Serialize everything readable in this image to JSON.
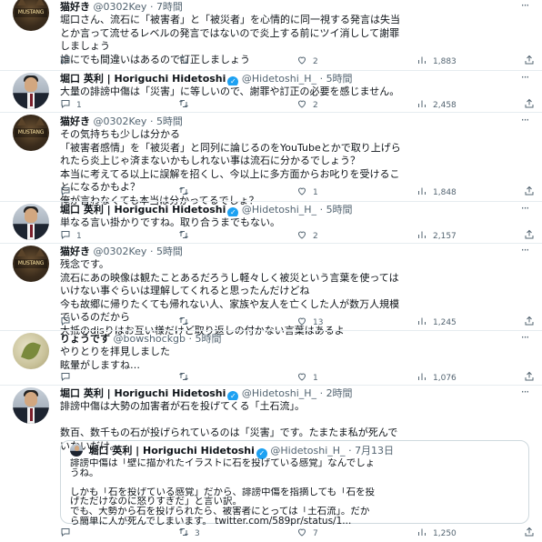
{
  "tweets": [
    {
      "name": "猫好き",
      "handle": "@0302Key",
      "dot": "·",
      "time": "7時間",
      "avatar_text": "MUSTANG",
      "lines": [
        "堀口さん、流石に「被害者」と「被災者」を心情的に同一視する発言は失当",
        "とか言って流せるレベルの発言ではないので炎上する前にツイ消しして謝罪",
        "しましょう",
        "誰にでも間違いはあるので訂正しましょう"
      ],
      "reply_count": "",
      "retweet_count": "",
      "like_count": "2",
      "stats_count": "1,883"
    },
    {
      "name": "堀口 英利 | Horiguchi Hidetoshi",
      "handle": "@Hidetoshi_H_",
      "dot": "·",
      "time": "5時間",
      "lines": [
        "大量の誹謗中傷は「災害」に等しいので、謝罪や訂正の必要を感じません。"
      ],
      "reply_count": "1",
      "retweet_count": "",
      "like_count": "2",
      "stats_count": "2,458"
    },
    {
      "name": "猫好き",
      "handle": "@0302Key",
      "dot": "·",
      "time": "5時間",
      "avatar_text": "MUSTANG",
      "lines": [
        "その気持ちも少しは分かる",
        "「被害者感情」を「被災者」と同列に論じるのをYouTubeとかで取り上げら",
        "れたら炎上じゃ済まないかもしれない事は流石に分かるでしょう？",
        "本当に考えてる以上に誤解を招くし、今以上に多方面からお叱りを受けるこ",
        "とになるかもよ？",
        "俺が言わなくても本当は分かってるでしょ？"
      ],
      "reply_count": "",
      "retweet_count": "",
      "like_count": "1",
      "stats_count": "1,848"
    },
    {
      "name": "堀口 英利 | Horiguchi Hidetoshi",
      "handle": "@Hidetoshi_H_",
      "dot": "·",
      "time": "5時間",
      "lines": [
        "単なる言い掛かりですね。取り合うまでもない。"
      ],
      "reply_count": "1",
      "retweet_count": "",
      "like_count": "2",
      "stats_count": "2,157"
    },
    {
      "name": "猫好き",
      "handle": "@0302Key",
      "dot": "·",
      "time": "5時間",
      "avatar_text": "MUSTANG",
      "lines": [
        "残念です。",
        "流石にあの映像は観たことあるだろうし軽々しく被災という言葉を使っては",
        "いけない事ぐらいは理解してくれると思ったんだけどね",
        "今も故郷に帰りたくても帰れない人、家族や友人を亡くした人が数万人規模",
        "でいるのだから",
        "大抵のdisりはお互い様だけど取り返しの付かない言葉はあるよ"
      ],
      "reply_count": "",
      "retweet_count": "",
      "like_count": "13",
      "stats_count": "1,245"
    },
    {
      "name": "りょうです",
      "handle": "@bowshockgb",
      "dot": "·",
      "time": "5時間",
      "lines": [
        "やりとりを拝見しました",
        "眩暈がしますね…"
      ],
      "reply_count": "",
      "retweet_count": "",
      "like_count": "1",
      "stats_count": "1,076"
    },
    {
      "name": "堀口 英利 | Horiguchi Hidetoshi",
      "handle": "@Hidetoshi_H_",
      "dot": "·",
      "time": "2時間",
      "lines": [
        "誹謗中傷は大勢の加害者が石を投げてくる「土石流」。",
        "",
        "数百、数千もの石が投げられているのは「災害」です。たまたま私が死んで",
        "いないだけ。"
      ],
      "reply_count": "",
      "retweet_count": "3",
      "like_count": "7",
      "stats_count": "1,250",
      "quote": {
        "name": "堀口 英利 | Horiguchi Hidetoshi",
        "handle": "@Hidetoshi_H_",
        "dot": "·",
        "time": "7月13日",
        "lines": [
          "誹謗中傷は「壁に描かれたイラストに石を投げている感覚」なんでしょ",
          "うね。",
          "",
          "しかも「石を投げている感覚」だから、誹謗中傷を指摘しても「石を投",
          "げただけなのに怒りすぎだ」と言い訳。",
          "でも、大勢から石を投げられたら、被害者にとっては「土石流」。だか",
          "ら簡単に人が死んでしまいます。 twitter.com/589pr/status/1..."
        ]
      }
    }
  ]
}
